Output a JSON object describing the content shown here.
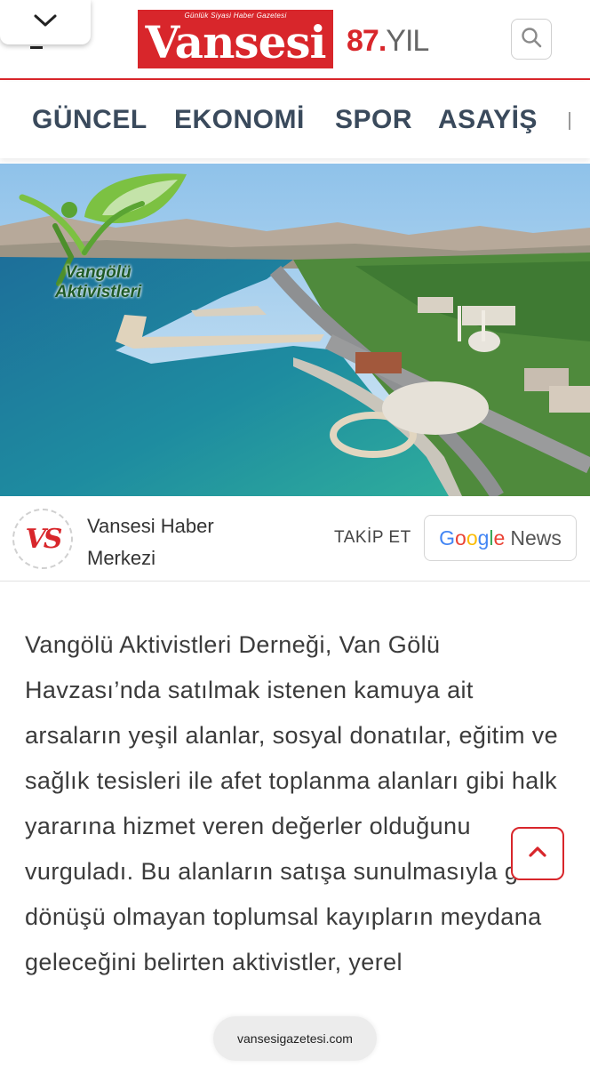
{
  "header": {
    "logo_tagline": "Günlük Siyasi Haber Gazetesi",
    "logo_word": "Vansesi",
    "year_number": "87.",
    "year_suffix": "YIL",
    "brand_color": "#d8262b",
    "icons": {
      "collapse": "chevron-down-icon",
      "menu": "menu-icon",
      "search": "search-icon"
    }
  },
  "nav": {
    "items": [
      {
        "label": "GÜNCEL"
      },
      {
        "label": "EKONOMİ"
      },
      {
        "label": "SPOR"
      },
      {
        "label": "ASAYİŞ"
      }
    ]
  },
  "hero": {
    "overlay_logo_line1": "Vangölü",
    "overlay_logo_line2": "Aktivistleri"
  },
  "author": {
    "avatar_text": "VS",
    "name": "Vansesi Haber Merkezi",
    "follow_label": "TAKİP ET",
    "gnews_letters": [
      "G",
      "o",
      "o",
      "g",
      "l",
      "e"
    ],
    "gnews_suffix": "News"
  },
  "article": {
    "body": "Vangölü Aktivistleri Derneği, Van Gölü Havzası’nda satılmak istenen kamuya ait arsaların yeşil alanlar, sosyal donatılar, eğitim ve sağlık tesisleri ile afet toplanma alanları gibi halk yararına hizmet veren değerler olduğunu vurguladı. Bu alanların satışa sunulmasıyla geri dönüşü olmayan toplumsal kayıpların meydana geleceğini belirten aktivistler, yerel"
  },
  "scroll_top": {
    "icon": "chevron-up-icon"
  },
  "browser": {
    "url": "vansesigazetesi.com"
  }
}
